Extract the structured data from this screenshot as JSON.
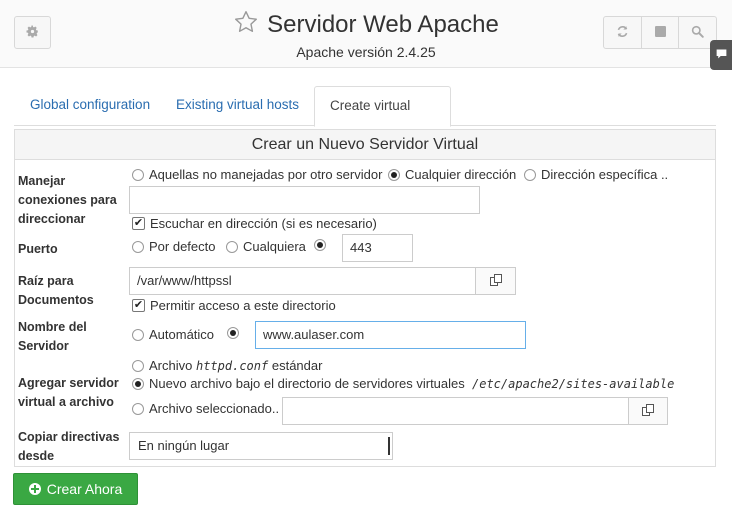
{
  "header": {
    "title": "Servidor Web Apache",
    "subtitle": "Apache versión 2.4.25",
    "icons": {
      "settings": "gear-icon",
      "favorite": "star-icon",
      "refresh": "refresh-icon",
      "stop": "stop-icon",
      "search": "search-icon",
      "side": "chat-icon"
    }
  },
  "tabs": [
    {
      "label": "Global configuration",
      "active": false
    },
    {
      "label": "Existing virtual hosts",
      "active": false
    },
    {
      "label": "Create virtual host",
      "active": true
    }
  ],
  "form": {
    "heading": "Crear un Nuevo Servidor Virtual",
    "address": {
      "label": "Manejar conexiones para direccionar",
      "options": [
        "Aquellas no manejadas por otro servidor",
        "Cualquier dirección",
        "Dirección específica .."
      ],
      "selected": 1,
      "value": "",
      "listen_label": "Escuchar en dirección (si es necesario)",
      "listen_checked": true
    },
    "port": {
      "label": "Puerto",
      "options": [
        "Por defecto",
        "Cualquiera"
      ],
      "selected": 2,
      "value": "443"
    },
    "docroot": {
      "label": "Raíz para Documentos",
      "value": "/var/www/httpssl",
      "allow_label": "Permitir acceso a este directorio",
      "allow_checked": true
    },
    "server_name": {
      "label": "Nombre del Servidor",
      "auto_label": "Automático",
      "selected": 1,
      "value": "www.aulaser.com"
    },
    "add_to": {
      "label": "Agregar servidor virtual a archivo",
      "opt1_prefix": "Archivo",
      "opt1_code": "httpd.conf",
      "opt1_suffix": "estándar",
      "opt2_text": "Nuevo archivo bajo el directorio de servidores virtuales",
      "opt2_code": "/etc/apache2/sites-available",
      "opt3_text": "Archivo seleccionado..",
      "selected": 1,
      "file_value": ""
    },
    "copy_from": {
      "label": "Copiar directivas desde",
      "selected_option": "En ningún lugar"
    }
  },
  "actions": {
    "create_label": "Crear Ahora"
  },
  "colors": {
    "tab_link": "#2a6db0",
    "create_button": "#3aa843",
    "focus_border": "#66afe9"
  }
}
